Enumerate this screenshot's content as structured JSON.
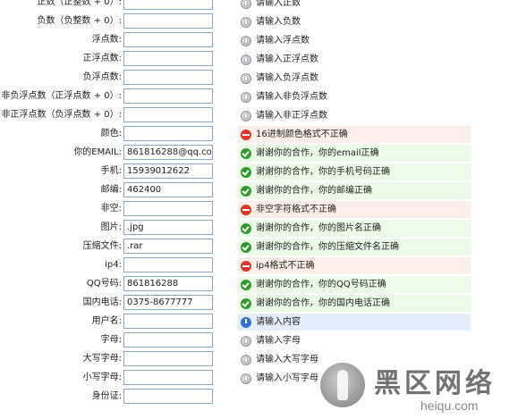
{
  "rows": [
    {
      "label": "正数（正整数 + 0）:",
      "value": "",
      "message": "请输入正数",
      "status": "info"
    },
    {
      "label": "负数（负整数 + 0）:",
      "value": "",
      "message": "请输入负数",
      "status": "info"
    },
    {
      "label": "浮点数:",
      "value": "",
      "message": "请输入浮点数",
      "status": "info"
    },
    {
      "label": "正浮点数:",
      "value": "",
      "message": "请输入正浮点数",
      "status": "info"
    },
    {
      "label": "负浮点数:",
      "value": "",
      "message": "请输入负浮点数",
      "status": "info"
    },
    {
      "label": "非负浮点数（正浮点数 + 0）:",
      "value": "",
      "message": "请输入非负浮点数",
      "status": "info"
    },
    {
      "label": "非正浮点数（负浮点数 + 0）:",
      "value": "",
      "message": "请输入非正浮点数",
      "status": "info"
    },
    {
      "label": "颜色:",
      "value": "",
      "message": "16进制颜色格式不正确",
      "status": "error"
    },
    {
      "label": "你的EMAIL:",
      "value": "861816288@qq.com",
      "message": "谢谢你的合作，你的email正确",
      "status": "ok"
    },
    {
      "label": "手机:",
      "value": "15939012622",
      "message": "谢谢你的合作，你的手机号码正确",
      "status": "ok"
    },
    {
      "label": "邮编:",
      "value": "462400",
      "message": "谢谢你的合作，你的邮编正确",
      "status": "ok"
    },
    {
      "label": "非空:",
      "value": "",
      "message": "非空字符格式不正确",
      "status": "error"
    },
    {
      "label": "图片:",
      "value": ".jpg",
      "message": "谢谢你的合作，你的图片名正确",
      "status": "ok"
    },
    {
      "label": "压缩文件:",
      "value": ".rar",
      "message": "谢谢你的合作，你的压缩文件名正确",
      "status": "ok"
    },
    {
      "label": "ip4:",
      "value": "",
      "message": "ip4格式不正确",
      "status": "error"
    },
    {
      "label": "QQ号码:",
      "value": "861816288",
      "message": "谢谢你的合作，你的QQ号码正确",
      "status": "ok"
    },
    {
      "label": "国内电话:",
      "value": "0375-8677777",
      "message": "谢谢你的合作，你的国内电话正确",
      "status": "ok"
    },
    {
      "label": "用户名:",
      "value": "",
      "message": "请输入内容",
      "status": "focus"
    },
    {
      "label": "字母:",
      "value": "",
      "message": "请输入字母",
      "status": "info"
    },
    {
      "label": "大写字母:",
      "value": "",
      "message": "请输入大写字母",
      "status": "info"
    },
    {
      "label": "小写字母:",
      "value": "",
      "message": "请输入小写字母",
      "status": "info"
    },
    {
      "label": "身份证:",
      "value": "",
      "message": "",
      "status": "none"
    }
  ],
  "icons": {
    "info": "info-icon",
    "error": "error-icon",
    "ok": "check-icon",
    "focus": "focus-info-icon"
  },
  "colors": {
    "error_bg": "#fdeee9",
    "ok_bg": "#ecfbe7",
    "focus_bg": "#e5eefb",
    "input_border": "#8fa6bf"
  },
  "watermark": {
    "text": "黑区网络",
    "url": "heiqu.com"
  }
}
